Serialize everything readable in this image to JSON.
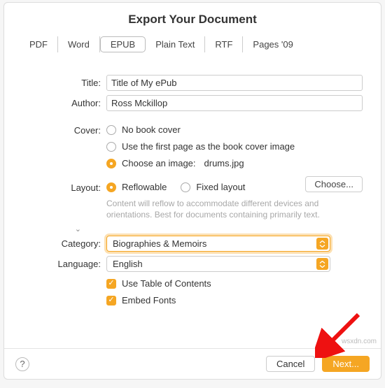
{
  "title": "Export Your Document",
  "tabs": {
    "pdf": "PDF",
    "word": "Word",
    "epub": "EPUB",
    "plain": "Plain Text",
    "rtf": "RTF",
    "pages09": "Pages '09"
  },
  "labels": {
    "title": "Title:",
    "author": "Author:",
    "cover": "Cover:",
    "layout": "Layout:",
    "category": "Category:",
    "language": "Language:"
  },
  "values": {
    "title": "Title of My ePub",
    "author": "Ross Mckillop",
    "cover_file": "drums.jpg",
    "category": "Biographies & Memoirs",
    "language": "English"
  },
  "cover_options": {
    "none": "No book cover",
    "first_page": "Use the first page as the book cover image",
    "choose": "Choose an image:"
  },
  "layout_options": {
    "reflowable": "Reflowable",
    "fixed": "Fixed layout"
  },
  "layout_help": "Content will reflow to accommodate different devices and orientations. Best for documents containing primarily text.",
  "checkboxes": {
    "toc": "Use Table of Contents",
    "fonts": "Embed Fonts"
  },
  "buttons": {
    "choose": "Choose...",
    "cancel": "Cancel",
    "next": "Next...",
    "help": "?"
  },
  "watermark": "wsxdn.com"
}
